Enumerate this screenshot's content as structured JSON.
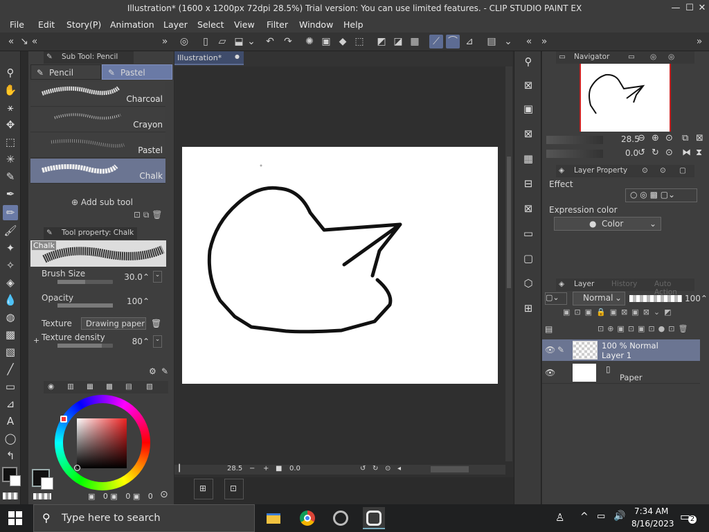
{
  "window": {
    "title": "Illustration* (1600 x 1200px 72dpi 28.5%)  Trial version: You can use limited features. - CLIP STUDIO PAINT EX",
    "minimize_glyph": "—",
    "maximize_glyph": "☐",
    "close_glyph": "✕"
  },
  "menu": [
    "File",
    "Edit",
    "Story(P)",
    "Animation",
    "Layer",
    "Select",
    "View",
    "Filter",
    "Window",
    "Help"
  ],
  "subtool_panel": {
    "title": "Sub Tool: Pencil",
    "tabs": [
      "Pencil",
      "Pastel"
    ],
    "active_tab": "Pastel",
    "items": [
      "Charcoal",
      "Crayon",
      "Pastel",
      "Chalk"
    ],
    "selected_item": "Chalk",
    "add_label": "Add sub tool"
  },
  "tool_property": {
    "title": "Tool property: Chalk",
    "preview_name": "Chalk",
    "brush_size_label": "Brush Size",
    "brush_size_value": "30.0",
    "brush_size_fraction": 0.5,
    "opacity_label": "Opacity",
    "opacity_value": "100",
    "opacity_fraction": 1.0,
    "texture_label": "Texture",
    "texture_value": "Drawing paper C",
    "texture_density_label": "Texture density",
    "texture_density_value": "80",
    "texture_density_fraction": 0.8
  },
  "color_panel": {
    "values": [
      "0",
      "0",
      "0"
    ]
  },
  "canvas_tab": {
    "label": "Illustration*",
    "dot": "●"
  },
  "canvas_status": {
    "zoom": "28.5",
    "angle": "0.0"
  },
  "navigator": {
    "title": "Navigator",
    "zoom": "28.5",
    "rotation": "0.0"
  },
  "layer_property": {
    "title": "Layer Property",
    "effect_label": "Effect",
    "expression_color_label": "Expression color",
    "expression_color_value": "Color"
  },
  "layer_panel": {
    "tabs": [
      "Layer",
      "History",
      "Auto Action"
    ],
    "blend_mode": "Normal",
    "opacity": "100",
    "layers": [
      {
        "line1": "100 % Normal",
        "line2": "Layer 1",
        "selected": true
      },
      {
        "line1": "",
        "line2": "Paper",
        "selected": false
      }
    ]
  },
  "taskbar": {
    "search_placeholder": "Type here to search",
    "time": "7:34 AM",
    "date": "8/16/2023",
    "notifications": "2"
  },
  "colors": {
    "accent": "#6a7aa6",
    "panel_bg": "#3e3e3e",
    "canvas_bg": "#2f2f2f",
    "main_color": "#111111",
    "sub_color": "#ffffff"
  }
}
